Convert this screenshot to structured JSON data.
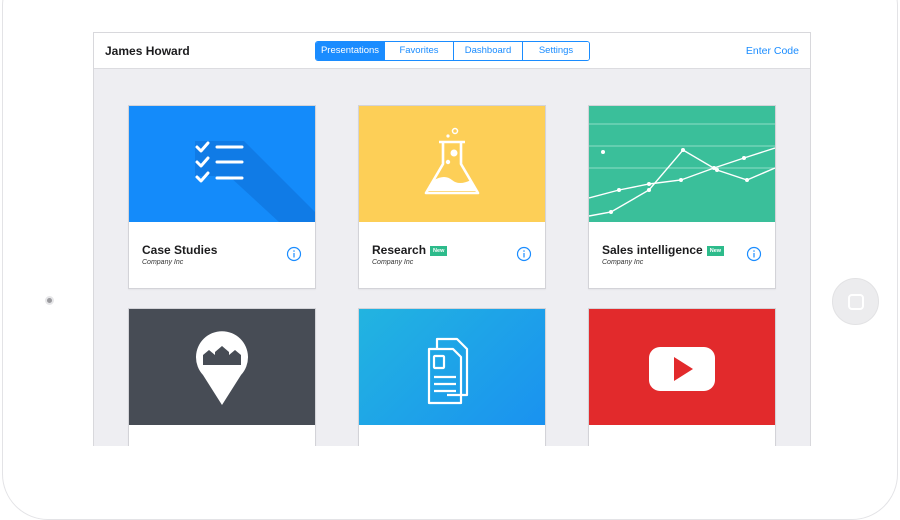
{
  "header": {
    "user_name": "James Howard",
    "enter_code": "Enter Code",
    "tabs": [
      {
        "label": "Presentations",
        "active": true
      },
      {
        "label": "Favorites",
        "active": false
      },
      {
        "label": "Dashboard",
        "active": false
      },
      {
        "label": "Settings",
        "active": false
      }
    ]
  },
  "cards": [
    {
      "title": "Case Studies",
      "company": "Company Inc",
      "badge": "",
      "color": "#148bfa",
      "icon": "checklist-icon"
    },
    {
      "title": "Research",
      "company": "Company Inc",
      "badge": "New",
      "color": "#fdcf57",
      "icon": "flask-icon"
    },
    {
      "title": "Sales intelligence",
      "company": "Company Inc",
      "badge": "New",
      "color": "#3abf9a",
      "icon": "line-chart-icon"
    },
    {
      "title": "",
      "company": "",
      "badge": "",
      "color": "#474c55",
      "icon": "map-pin-icon"
    },
    {
      "title": "",
      "company": "",
      "badge": "",
      "color": "#1da7e6",
      "icon": "document-icon"
    },
    {
      "title": "",
      "company": "",
      "badge": "",
      "color": "#e22a2c",
      "icon": "youtube-icon"
    }
  ],
  "colors": {
    "accent": "#1a8cff",
    "badge": "#2dbb8b",
    "background": "#eeeef2"
  }
}
